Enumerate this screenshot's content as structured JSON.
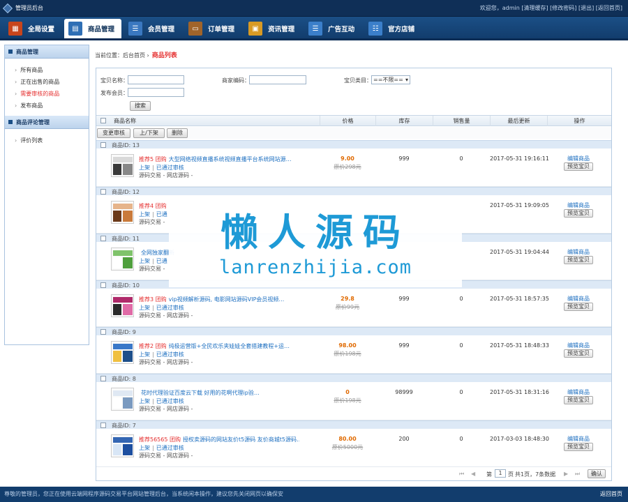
{
  "topbar": {
    "title": "管理员后台",
    "links": "欢迎您，admin [清理缓存] [修改密码] [退出] [返回首页]"
  },
  "nav": [
    {
      "label": "全局设置",
      "icon": "settings-icon",
      "color": "#c8451c"
    },
    {
      "label": "商品管理",
      "icon": "shop-icon",
      "color": "#2f6fb5"
    },
    {
      "label": "会员管理",
      "icon": "members-icon",
      "color": "#3a78c0"
    },
    {
      "label": "订单管理",
      "icon": "order-icon",
      "color": "#a0642a"
    },
    {
      "label": "资讯管理",
      "icon": "news-icon",
      "color": "#d89a24"
    },
    {
      "label": "广告互动",
      "icon": "ad-icon",
      "color": "#3b7fca"
    },
    {
      "label": "官方店铺",
      "icon": "store-icon",
      "color": "#3b7fca"
    }
  ],
  "sidebar": {
    "section1": "商品管理",
    "items1": [
      "所有商品",
      "正在出售的商品",
      "需要审核的商品",
      "发布商品"
    ],
    "section2": "商品评论管理",
    "items2": [
      "评价列表"
    ]
  },
  "breadcrumb": {
    "prefix": "当前位置：后台首页 ›",
    "current": "商品列表"
  },
  "search": {
    "name_label": "宝贝名称：",
    "seller_label": "商家编码：",
    "category_label": "宝贝类目：",
    "category_value": "==不限==",
    "publisher_label": "发布会员：",
    "search_button": "搜索"
  },
  "table": {
    "headers": [
      "商品名称",
      "价格",
      "库存",
      "销售量",
      "最后更新",
      "操作"
    ],
    "actions": [
      "变更审核",
      "上/下架",
      "删除"
    ]
  },
  "rows": [
    {
      "group": "商品ID: 13",
      "tags": "推荐5 团购",
      "title": "大型网络视频直播系统视频直播平台系统网站源…",
      "status": "上架",
      "audit": "已通过审核",
      "source": "源码交易 - 网店源码 -",
      "price": "9.00",
      "oprice": "原价298元",
      "stock": "999",
      "sold": "0",
      "updated": "2017-05-31 19:16:11",
      "edit": "编辑商品",
      "preview": "预览宝贝"
    },
    {
      "group": "商品ID: 12",
      "tags": "推荐4 团购",
      "title": "",
      "status": "上架",
      "audit": "已通",
      "source": "源码交易 -",
      "price": "",
      "oprice": "",
      "stock": "",
      "sold": "",
      "updated": "2017-05-31 19:09:05",
      "edit": "编辑商品",
      "preview": "预览宝贝"
    },
    {
      "group": "商品ID: 11",
      "tags": "",
      "title": "全网独家翻新",
      "status": "上架",
      "audit": "已通",
      "source": "源码交易 -",
      "price": "",
      "oprice": "",
      "stock": "",
      "sold": "",
      "updated": "2017-05-31 19:04:44",
      "edit": "编辑商品",
      "preview": "预览宝贝"
    },
    {
      "group": "商品ID: 10",
      "tags": "推荐3 团购",
      "title": "vip视频解析源码, 电影网站源码VIP会员视频…",
      "status": "上架",
      "audit": "已通过审核",
      "source": "源码交易 - 网店源码 -",
      "price": "29.8",
      "oprice": "原价99元",
      "stock": "999",
      "sold": "0",
      "updated": "2017-05-31 18:57:35",
      "edit": "编辑商品",
      "preview": "预览宝贝"
    },
    {
      "group": "商品ID: 9",
      "tags": "推荐2 团购",
      "title": "纯极运营版+全民欢乐夹娃娃全套搭建教程+运…",
      "status": "上架",
      "audit": "已通过审核",
      "source": "源码交易 - 网店源码 -",
      "price": "98.00",
      "oprice": "原价198元",
      "stock": "999",
      "sold": "0",
      "updated": "2017-05-31 18:48:33",
      "edit": "编辑商品",
      "preview": "预览宝贝"
    },
    {
      "group": "商品ID: 8",
      "tags": "",
      "title": "花时代理验证百度云下载 好用的花啊代理ip验…",
      "status": "上架",
      "audit": "已通过审核",
      "source": "源码交易 - 网店源码 -",
      "price": "0",
      "oprice": "原价198元",
      "stock": "98999",
      "sold": "0",
      "updated": "2017-05-31 18:31:16",
      "edit": "编辑商品",
      "preview": "预览宝贝"
    },
    {
      "group": "商品ID: 7",
      "tags": "推荐56565 团购",
      "title": "授权卖源码的网站友价t5源码 友价商城t5源码…",
      "status": "上架",
      "audit": "已通过审核",
      "source": "源码交易 - 网店源码 -",
      "price": "80.00",
      "oprice": "原价5000元",
      "stock": "200",
      "sold": "0",
      "updated": "2017-03-03 18:48:30",
      "edit": "编辑商品",
      "preview": "预览宝贝"
    }
  ],
  "pager": {
    "page_prefix": "第",
    "page": "1",
    "page_suffix": "页",
    "info": "共1页，7条数据",
    "confirm": "确认"
  },
  "footer": {
    "text": "尊敬的管理员，您正在使用云端网程序源码交易平台网站管理后台，当系统闲本操作，建议您先关闭网页以确保安",
    "back": "返回首页"
  },
  "watermark": {
    "cn": "懒人源码",
    "en": "lanrenzhijia.com"
  }
}
